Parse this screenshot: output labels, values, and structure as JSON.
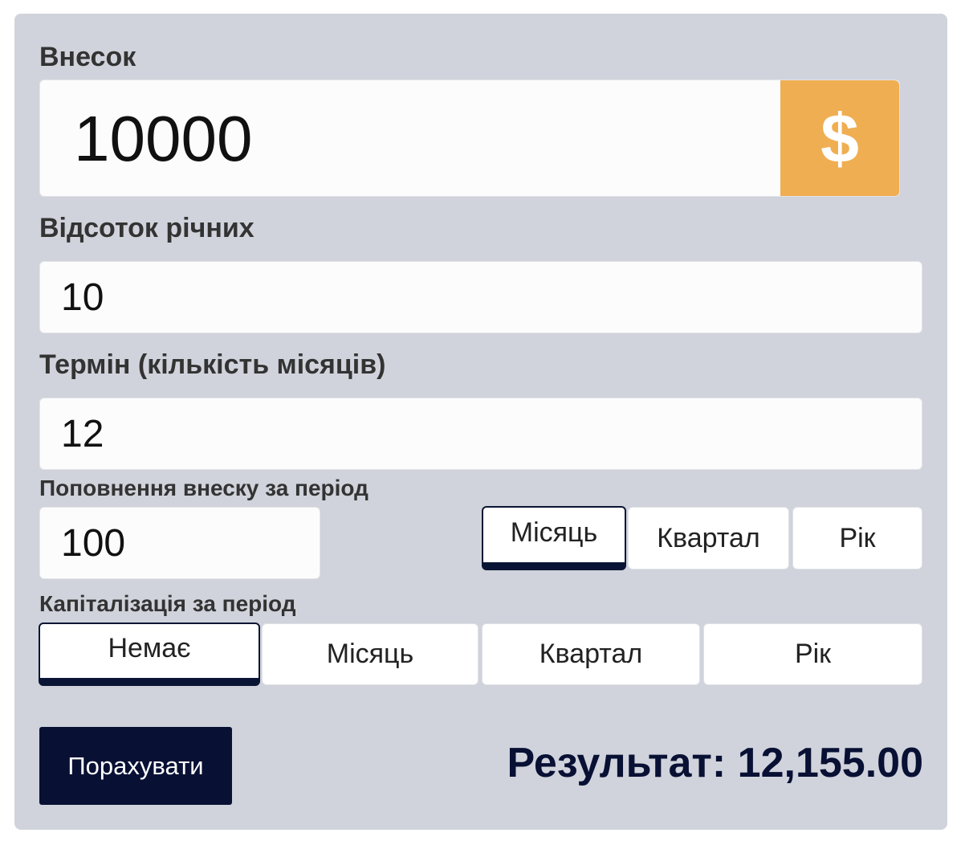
{
  "deposit": {
    "label": "Внесок",
    "value": "10000",
    "currency_symbol": "$",
    "currency_color": "#f0ae52"
  },
  "rate": {
    "label": "Відсоток річних",
    "value": "10"
  },
  "term": {
    "label": "Термін (кількість місяців)",
    "value": "12"
  },
  "topup": {
    "label": "Поповнення внеску за період",
    "value": "100",
    "periods": [
      "Місяць",
      "Квартал",
      "Рік"
    ],
    "selected": "Місяць"
  },
  "capitalization": {
    "label": "Капіталізація за період",
    "periods": [
      "Немає",
      "Місяць",
      "Квартал",
      "Рік"
    ],
    "selected": "Немає"
  },
  "actions": {
    "calculate_label": "Порахувати"
  },
  "result": {
    "text": "Результат: 12,155.00"
  },
  "theme": {
    "panel_bg": "#d0d3db",
    "accent_dark": "#081034"
  }
}
